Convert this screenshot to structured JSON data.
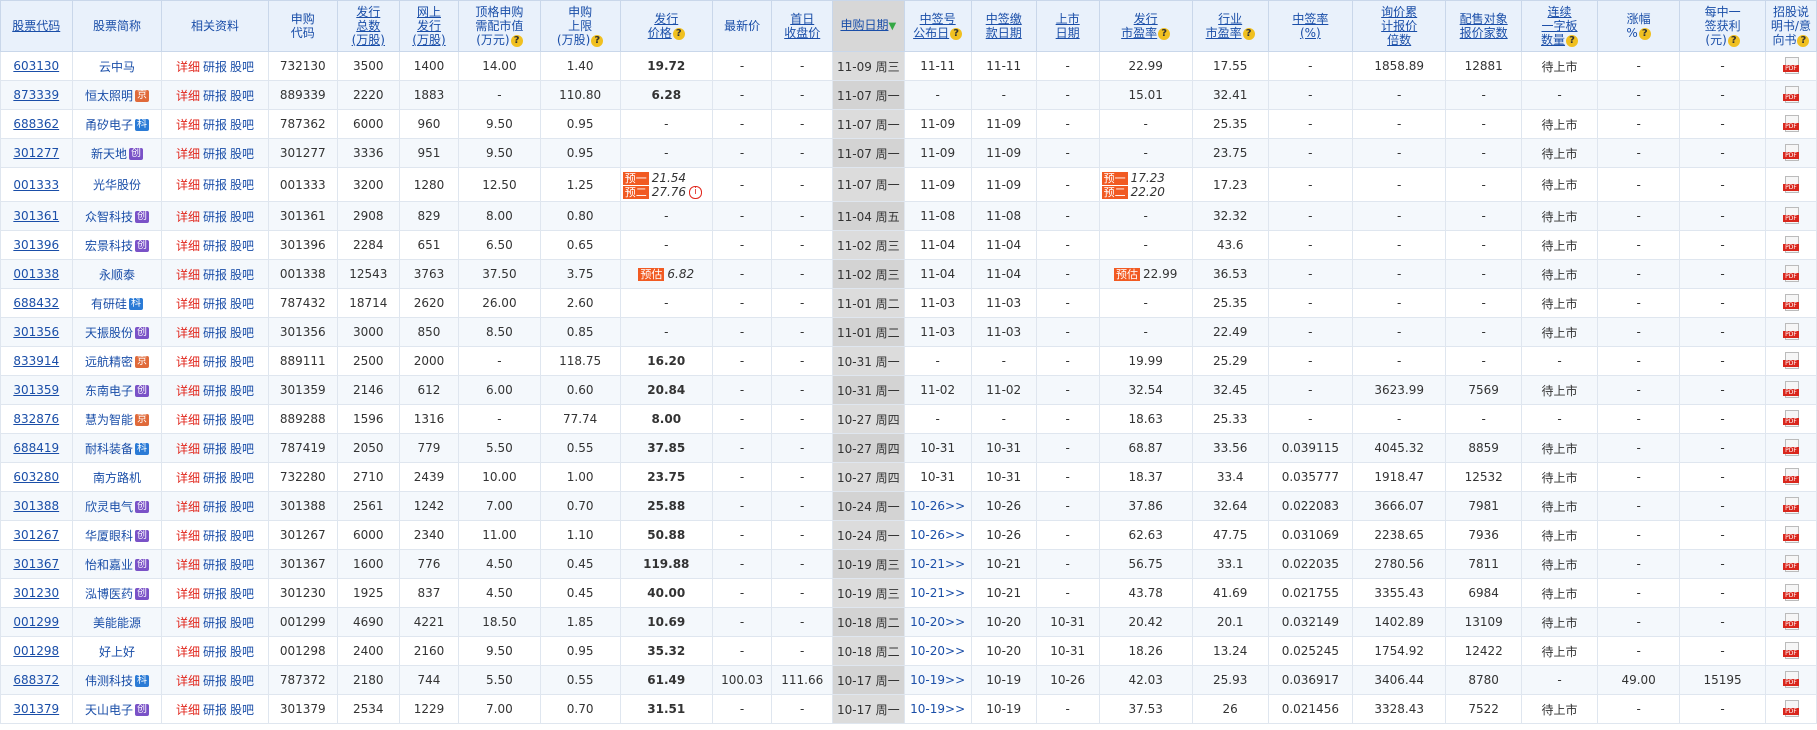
{
  "headers": [
    {
      "label": "股票代码",
      "q": false,
      "u": true
    },
    {
      "label": "股票简称",
      "q": false
    },
    {
      "label": "相关资料",
      "q": false
    },
    {
      "label": "申购\n代码",
      "q": false
    },
    {
      "label": "发行\n总数\n(万股)",
      "q": false,
      "u": true
    },
    {
      "label": "网上\n发行\n(万股)",
      "q": false,
      "u": true
    },
    {
      "label": "顶格申购\n需配市值\n(万元)",
      "q": true
    },
    {
      "label": "申购\n上限\n(万股)",
      "q": true
    },
    {
      "label": "发行\n价格",
      "q": true,
      "u": true
    },
    {
      "label": "最新价",
      "q": false
    },
    {
      "label": "首日\n收盘价",
      "q": false,
      "u": true
    },
    {
      "label": "申购日期",
      "q": false,
      "u": true,
      "sorted": true,
      "arrow": "▼"
    },
    {
      "label": "中签号\n公布日",
      "q": true,
      "u": true
    },
    {
      "label": "中签缴\n款日期",
      "q": false,
      "u": true
    },
    {
      "label": "上市\n日期",
      "q": false,
      "u": true
    },
    {
      "label": "发行\n市盈率",
      "q": true,
      "u": true
    },
    {
      "label": "行业\n市盈率",
      "q": true,
      "u": true
    },
    {
      "label": "中签率\n(%)",
      "q": false,
      "u": true
    },
    {
      "label": "询价累\n计报价\n倍数",
      "q": false,
      "u": true
    },
    {
      "label": "配售对象\n报价家数",
      "q": false,
      "u": true
    },
    {
      "label": "连续\n一字板\n数量",
      "q": true,
      "u": true
    },
    {
      "label": "涨幅\n%",
      "q": true
    },
    {
      "label": "每中一\n签获利\n(元)",
      "q": true
    },
    {
      "label": "招股说\n明书/意\n向书",
      "q": true
    }
  ],
  "links": {
    "detail": "详细",
    "research": "研报",
    "forum": "股吧",
    "pdf": "PDF",
    "pred_tag": "预估",
    "pred1": "预一",
    "pred2": "预二"
  },
  "rows": [
    {
      "code": "603130",
      "name": "云中马",
      "tag": "",
      "subcode": "732130",
      "total": "3500",
      "online": "1400",
      "need": "14.00",
      "limit": "1.40",
      "price": "19.72",
      "price_bold": true,
      "latest": "-",
      "first": "-",
      "date": "11-09 周三",
      "announce": "11-11",
      "announce_link": false,
      "pay": "11-11",
      "list": "-",
      "pe": "22.99",
      "ipe": "17.55",
      "rate": "-",
      "mult": "1858.89",
      "count": "12881",
      "limit_up": "待上市",
      "rise": "-",
      "profit": "-"
    },
    {
      "code": "873339",
      "name": "恒太照明",
      "tag": "京",
      "subcode": "889339",
      "total": "2220",
      "online": "1883",
      "need": "-",
      "limit": "110.80",
      "price": "6.28",
      "price_bold": true,
      "latest": "-",
      "first": "-",
      "date": "11-07 周一",
      "announce": "-",
      "announce_link": false,
      "pay": "-",
      "list": "-",
      "pe": "15.01",
      "ipe": "32.41",
      "rate": "-",
      "mult": "-",
      "count": "-",
      "limit_up": "-",
      "rise": "-",
      "profit": "-"
    },
    {
      "code": "688362",
      "name": "甬矽电子",
      "tag": "科",
      "subcode": "787362",
      "total": "6000",
      "online": "960",
      "need": "9.50",
      "limit": "0.95",
      "price": "-",
      "price_bold": false,
      "latest": "-",
      "first": "-",
      "date": "11-07 周一",
      "announce": "11-09",
      "announce_link": false,
      "pay": "11-09",
      "list": "-",
      "pe": "-",
      "ipe": "25.35",
      "rate": "-",
      "mult": "-",
      "count": "-",
      "limit_up": "待上市",
      "rise": "-",
      "profit": "-"
    },
    {
      "code": "301277",
      "name": "新天地",
      "tag": "创",
      "subcode": "301277",
      "total": "3336",
      "online": "951",
      "need": "9.50",
      "limit": "0.95",
      "price": "-",
      "price_bold": false,
      "latest": "-",
      "first": "-",
      "date": "11-07 周一",
      "announce": "11-09",
      "announce_link": false,
      "pay": "11-09",
      "list": "-",
      "pe": "-",
      "ipe": "23.75",
      "rate": "-",
      "mult": "-",
      "count": "-",
      "limit_up": "待上市",
      "rise": "-",
      "profit": "-"
    },
    {
      "code": "001333",
      "name": "光华股份",
      "tag": "",
      "subcode": "001333",
      "total": "3200",
      "online": "1280",
      "need": "12.50",
      "limit": "1.25",
      "price": "",
      "price_pred": [
        "21.54",
        "27.76"
      ],
      "price_bold": false,
      "latest": "-",
      "first": "-",
      "date": "11-07 周一",
      "announce": "11-09",
      "announce_link": false,
      "pay": "11-09",
      "list": "-",
      "pe": "",
      "pe_pred": [
        "17.23",
        "22.20"
      ],
      "ipe": "17.23",
      "rate": "-",
      "mult": "-",
      "count": "-",
      "limit_up": "待上市",
      "rise": "-",
      "profit": "-",
      "tall": true
    },
    {
      "code": "301361",
      "name": "众智科技",
      "tag": "创",
      "subcode": "301361",
      "total": "2908",
      "online": "829",
      "need": "8.00",
      "limit": "0.80",
      "price": "-",
      "price_bold": false,
      "latest": "-",
      "first": "-",
      "date": "11-04 周五",
      "announce": "11-08",
      "announce_link": false,
      "pay": "11-08",
      "list": "-",
      "pe": "-",
      "ipe": "32.32",
      "rate": "-",
      "mult": "-",
      "count": "-",
      "limit_up": "待上市",
      "rise": "-",
      "profit": "-"
    },
    {
      "code": "301396",
      "name": "宏景科技",
      "tag": "创",
      "subcode": "301396",
      "total": "2284",
      "online": "651",
      "need": "6.50",
      "limit": "0.65",
      "price": "-",
      "price_bold": false,
      "latest": "-",
      "first": "-",
      "date": "11-02 周三",
      "announce": "11-04",
      "announce_link": false,
      "pay": "11-04",
      "list": "-",
      "pe": "-",
      "ipe": "43.6",
      "rate": "-",
      "mult": "-",
      "count": "-",
      "limit_up": "待上市",
      "rise": "-",
      "profit": "-"
    },
    {
      "code": "001338",
      "name": "永顺泰",
      "tag": "",
      "subcode": "001338",
      "total": "12543",
      "online": "3763",
      "need": "37.50",
      "limit": "3.75",
      "price": "",
      "price_single": "6.82",
      "price_bold": false,
      "latest": "-",
      "first": "-",
      "date": "11-02 周三",
      "announce": "11-04",
      "announce_link": false,
      "pay": "11-04",
      "list": "-",
      "pe": "",
      "pe_single": "22.99",
      "ipe": "36.53",
      "rate": "-",
      "mult": "-",
      "count": "-",
      "limit_up": "待上市",
      "rise": "-",
      "profit": "-"
    },
    {
      "code": "688432",
      "name": "有研硅",
      "tag": "科",
      "subcode": "787432",
      "total": "18714",
      "online": "2620",
      "need": "26.00",
      "limit": "2.60",
      "price": "-",
      "price_bold": false,
      "latest": "-",
      "first": "-",
      "date": "11-01 周二",
      "announce": "11-03",
      "announce_link": false,
      "pay": "11-03",
      "list": "-",
      "pe": "-",
      "ipe": "25.35",
      "rate": "-",
      "mult": "-",
      "count": "-",
      "limit_up": "待上市",
      "rise": "-",
      "profit": "-"
    },
    {
      "code": "301356",
      "name": "天振股份",
      "tag": "创",
      "subcode": "301356",
      "total": "3000",
      "online": "850",
      "need": "8.50",
      "limit": "0.85",
      "price": "-",
      "price_bold": false,
      "latest": "-",
      "first": "-",
      "date": "11-01 周二",
      "announce": "11-03",
      "announce_link": false,
      "pay": "11-03",
      "list": "-",
      "pe": "-",
      "ipe": "22.49",
      "rate": "-",
      "mult": "-",
      "count": "-",
      "limit_up": "待上市",
      "rise": "-",
      "profit": "-"
    },
    {
      "code": "833914",
      "name": "远航精密",
      "tag": "京",
      "subcode": "889111",
      "total": "2500",
      "online": "2000",
      "need": "-",
      "limit": "118.75",
      "price": "16.20",
      "price_bold": true,
      "latest": "-",
      "first": "-",
      "date": "10-31 周一",
      "announce": "-",
      "announce_link": false,
      "pay": "-",
      "list": "-",
      "pe": "19.99",
      "ipe": "25.29",
      "rate": "-",
      "mult": "-",
      "count": "-",
      "limit_up": "-",
      "rise": "-",
      "profit": "-"
    },
    {
      "code": "301359",
      "name": "东南电子",
      "tag": "创",
      "subcode": "301359",
      "total": "2146",
      "online": "612",
      "need": "6.00",
      "limit": "0.60",
      "price": "20.84",
      "price_bold": true,
      "latest": "-",
      "first": "-",
      "date": "10-31 周一",
      "announce": "11-02",
      "announce_link": false,
      "pay": "11-02",
      "list": "-",
      "pe": "32.54",
      "ipe": "32.45",
      "rate": "-",
      "mult": "3623.99",
      "count": "7569",
      "limit_up": "待上市",
      "rise": "-",
      "profit": "-"
    },
    {
      "code": "832876",
      "name": "慧为智能",
      "tag": "京",
      "subcode": "889288",
      "total": "1596",
      "online": "1316",
      "need": "-",
      "limit": "77.74",
      "price": "8.00",
      "price_bold": true,
      "latest": "-",
      "first": "-",
      "date": "10-27 周四",
      "announce": "-",
      "announce_link": false,
      "pay": "-",
      "list": "-",
      "pe": "18.63",
      "ipe": "25.33",
      "rate": "-",
      "mult": "-",
      "count": "-",
      "limit_up": "-",
      "rise": "-",
      "profit": "-"
    },
    {
      "code": "688419",
      "name": "耐科装备",
      "tag": "科",
      "subcode": "787419",
      "total": "2050",
      "online": "779",
      "need": "5.50",
      "limit": "0.55",
      "price": "37.85",
      "price_bold": true,
      "latest": "-",
      "first": "-",
      "date": "10-27 周四",
      "announce": "10-31",
      "announce_link": false,
      "pay": "10-31",
      "list": "-",
      "pe": "68.87",
      "ipe": "33.56",
      "rate": "0.039115",
      "mult": "4045.32",
      "count": "8859",
      "limit_up": "待上市",
      "rise": "-",
      "profit": "-"
    },
    {
      "code": "603280",
      "name": "南方路机",
      "tag": "",
      "subcode": "732280",
      "total": "2710",
      "online": "2439",
      "need": "10.00",
      "limit": "1.00",
      "price": "23.75",
      "price_bold": true,
      "latest": "-",
      "first": "-",
      "date": "10-27 周四",
      "announce": "10-31",
      "announce_link": false,
      "pay": "10-31",
      "list": "-",
      "pe": "18.37",
      "ipe": "33.4",
      "rate": "0.035777",
      "mult": "1918.47",
      "count": "12532",
      "limit_up": "待上市",
      "rise": "-",
      "profit": "-"
    },
    {
      "code": "301388",
      "name": "欣灵电气",
      "tag": "创",
      "subcode": "301388",
      "total": "2561",
      "online": "1242",
      "need": "7.00",
      "limit": "0.70",
      "price": "25.88",
      "price_bold": true,
      "latest": "-",
      "first": "-",
      "date": "10-24 周一",
      "announce": "10-26>>",
      "announce_link": true,
      "pay": "10-26",
      "list": "-",
      "pe": "37.86",
      "ipe": "32.64",
      "rate": "0.022083",
      "mult": "3666.07",
      "count": "7981",
      "limit_up": "待上市",
      "rise": "-",
      "profit": "-"
    },
    {
      "code": "301267",
      "name": "华厦眼科",
      "tag": "创",
      "subcode": "301267",
      "total": "6000",
      "online": "2340",
      "need": "11.00",
      "limit": "1.10",
      "price": "50.88",
      "price_bold": true,
      "latest": "-",
      "first": "-",
      "date": "10-24 周一",
      "announce": "10-26>>",
      "announce_link": true,
      "pay": "10-26",
      "list": "-",
      "pe": "62.63",
      "ipe": "47.75",
      "rate": "0.031069",
      "mult": "2238.65",
      "count": "7936",
      "limit_up": "待上市",
      "rise": "-",
      "profit": "-"
    },
    {
      "code": "301367",
      "name": "怡和嘉业",
      "tag": "创",
      "subcode": "301367",
      "total": "1600",
      "online": "776",
      "need": "4.50",
      "limit": "0.45",
      "price": "119.88",
      "price_bold": true,
      "latest": "-",
      "first": "-",
      "date": "10-19 周三",
      "announce": "10-21>>",
      "announce_link": true,
      "pay": "10-21",
      "list": "-",
      "pe": "56.75",
      "ipe": "33.1",
      "rate": "0.022035",
      "mult": "2780.56",
      "count": "7811",
      "limit_up": "待上市",
      "rise": "-",
      "profit": "-"
    },
    {
      "code": "301230",
      "name": "泓博医药",
      "tag": "创",
      "subcode": "301230",
      "total": "1925",
      "online": "837",
      "need": "4.50",
      "limit": "0.45",
      "price": "40.00",
      "price_bold": true,
      "latest": "-",
      "first": "-",
      "date": "10-19 周三",
      "announce": "10-21>>",
      "announce_link": true,
      "pay": "10-21",
      "list": "-",
      "pe": "43.78",
      "ipe": "41.69",
      "rate": "0.021755",
      "mult": "3355.43",
      "count": "6984",
      "limit_up": "待上市",
      "rise": "-",
      "profit": "-"
    },
    {
      "code": "001299",
      "name": "美能能源",
      "tag": "",
      "subcode": "001299",
      "total": "4690",
      "online": "4221",
      "need": "18.50",
      "limit": "1.85",
      "price": "10.69",
      "price_bold": true,
      "latest": "-",
      "first": "-",
      "date": "10-18 周二",
      "announce": "10-20>>",
      "announce_link": true,
      "pay": "10-20",
      "list": "10-31",
      "pe": "20.42",
      "ipe": "20.1",
      "rate": "0.032149",
      "mult": "1402.89",
      "count": "13109",
      "limit_up": "待上市",
      "rise": "-",
      "profit": "-"
    },
    {
      "code": "001298",
      "name": "好上好",
      "tag": "",
      "subcode": "001298",
      "total": "2400",
      "online": "2160",
      "need": "9.50",
      "limit": "0.95",
      "price": "35.32",
      "price_bold": true,
      "latest": "-",
      "first": "-",
      "date": "10-18 周二",
      "announce": "10-20>>",
      "announce_link": true,
      "pay": "10-20",
      "list": "10-31",
      "pe": "18.26",
      "ipe": "13.24",
      "rate": "0.025245",
      "mult": "1754.92",
      "count": "12422",
      "limit_up": "待上市",
      "rise": "-",
      "profit": "-"
    },
    {
      "code": "688372",
      "name": "伟测科技",
      "tag": "科",
      "subcode": "787372",
      "total": "2180",
      "online": "744",
      "need": "5.50",
      "limit": "0.55",
      "price": "61.49",
      "price_bold": true,
      "latest": "100.03",
      "first": "111.66",
      "date": "10-17 周一",
      "announce": "10-19>>",
      "announce_link": true,
      "pay": "10-19",
      "list": "10-26",
      "pe": "42.03",
      "ipe": "25.93",
      "rate": "0.036917",
      "mult": "3406.44",
      "count": "8780",
      "limit_up": "-",
      "rise": "49.00",
      "profit": "15195"
    },
    {
      "code": "301379",
      "name": "天山电子",
      "tag": "创",
      "subcode": "301379",
      "total": "2534",
      "online": "1229",
      "need": "7.00",
      "limit": "0.70",
      "price": "31.51",
      "price_bold": true,
      "latest": "-",
      "first": "-",
      "date": "10-17 周一",
      "announce": "10-19>>",
      "announce_link": true,
      "pay": "10-19",
      "list": "-",
      "pe": "37.53",
      "ipe": "26",
      "rate": "0.021456",
      "mult": "3328.43",
      "count": "7522",
      "limit_up": "待上市",
      "rise": "-",
      "profit": "-"
    }
  ]
}
